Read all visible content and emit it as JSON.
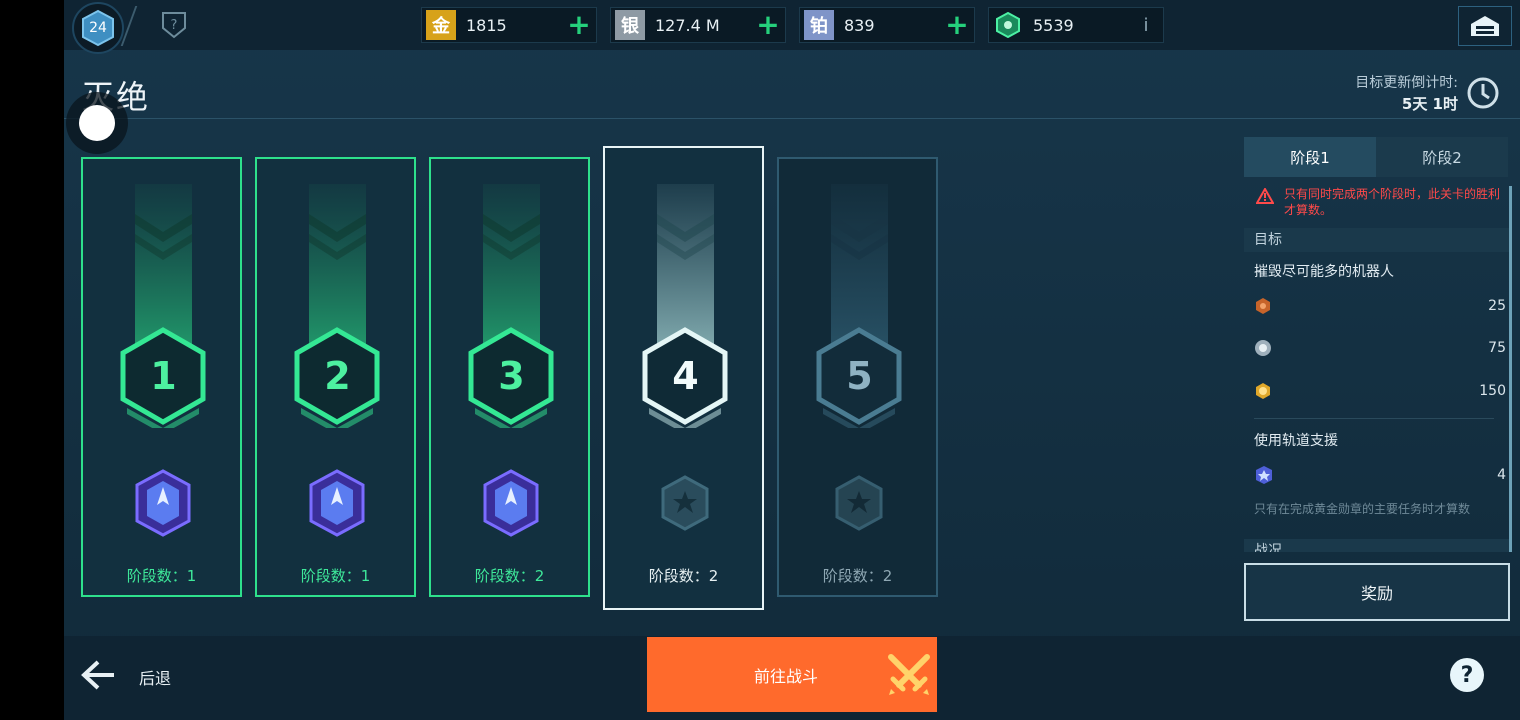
{
  "player": {
    "level": "24"
  },
  "currencies": [
    {
      "name": "gold",
      "icon_char": "金",
      "value": "1815",
      "color": "#d7a21a"
    },
    {
      "name": "silver",
      "icon_char": "银",
      "value": "127.4 M",
      "color": "#8e9aa4"
    },
    {
      "name": "platinum",
      "icon_char": "铂",
      "value": "839",
      "color": "#7f94c8"
    },
    {
      "name": "key",
      "icon_char": "",
      "value": "5539",
      "color": "#25d07c"
    }
  ],
  "title": "灭绝",
  "countdown": {
    "label": "目标更新倒计时:",
    "value": "5天 1时"
  },
  "stages": [
    {
      "number": "1",
      "count_text": "阶段数：1",
      "state": "completed"
    },
    {
      "number": "2",
      "count_text": "阶段数：1",
      "state": "completed"
    },
    {
      "number": "3",
      "count_text": "阶段数：2",
      "state": "completed"
    },
    {
      "number": "4",
      "count_text": "阶段数：2",
      "state": "current"
    },
    {
      "number": "5",
      "count_text": "阶段数：2",
      "state": "locked"
    }
  ],
  "panel": {
    "tabs": [
      "阶段1",
      "阶段2"
    ],
    "active_tab": "阶段1",
    "warning": "只有同时完成两个阶段时，此关卡的胜利才算数。",
    "objective_header": "目标",
    "objective_text": "摧毁尽可能多的机器人",
    "rewards": [
      {
        "icon": "bronze-robot-icon",
        "value": "25"
      },
      {
        "icon": "silver-robot-icon",
        "value": "75"
      },
      {
        "icon": "gold-robot-icon",
        "value": "150"
      }
    ],
    "secondary_text": "使用轨道支援",
    "secondary_value": "4",
    "note": "只有在完成黄金勋章的主要任务时才算数",
    "next_header": "战况"
  },
  "buttons": {
    "rewards": "奖励",
    "battle": "前往战斗",
    "back": "后退",
    "help": "?"
  },
  "colors": {
    "accent": "#2ee08c",
    "battle": "#ff6a2c",
    "warning": "#ff4a4a"
  }
}
